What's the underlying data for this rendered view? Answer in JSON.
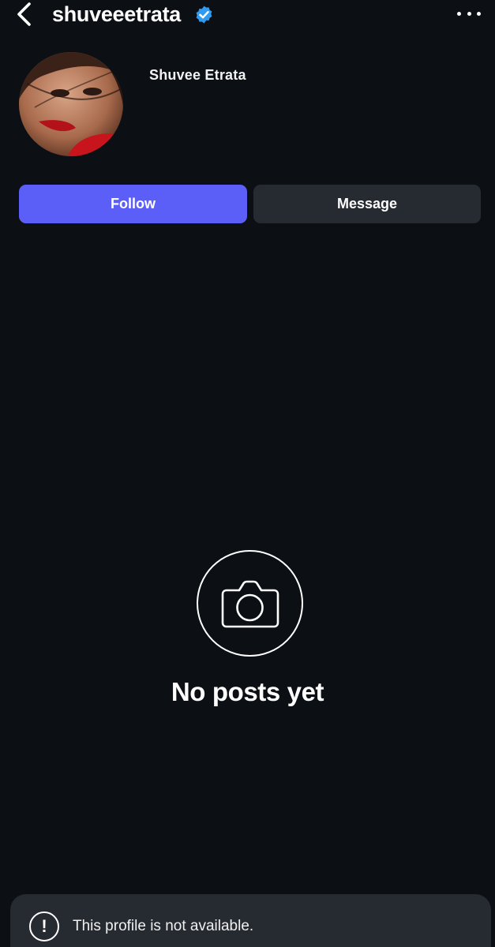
{
  "header": {
    "username": "shuveeetrata",
    "back_icon": "chevron-left-icon",
    "verified_icon": "verified-badge-icon",
    "more_icon": "more-horizontal-icon"
  },
  "profile": {
    "display_name": "Shuvee Etrata",
    "avatar_icon": "profile-photo"
  },
  "actions": {
    "follow_label": "Follow",
    "message_label": "Message"
  },
  "empty_state": {
    "icon": "camera-icon",
    "title": "No posts yet"
  },
  "toast": {
    "icon": "alert-circle-icon",
    "message": "This profile is not available."
  },
  "colors": {
    "background": "#0c1015",
    "follow_button": "#5b5ff7",
    "secondary_button": "#262a31",
    "verified_badge": "#2f9bf0"
  }
}
